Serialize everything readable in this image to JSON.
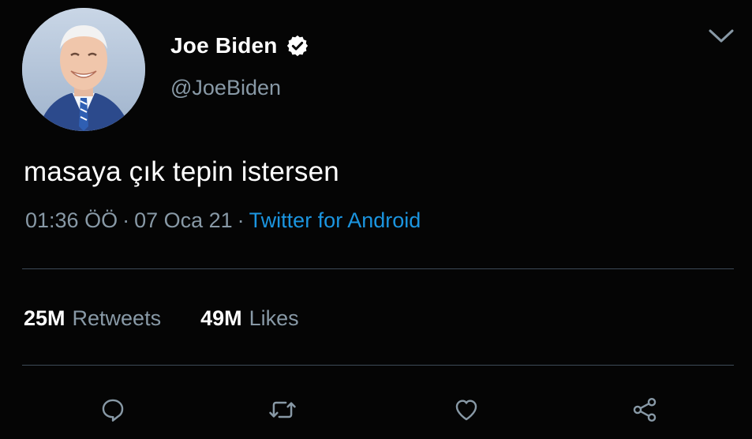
{
  "author": {
    "display_name": "Joe Biden",
    "handle": "@JoeBiden",
    "verified": true,
    "avatar_icon": "profile-photo"
  },
  "tweet": {
    "text": "masaya çık tepin istersen",
    "time": "01:36 ÖÖ",
    "date": "07 Oca 21",
    "separator": "·",
    "source": "Twitter for Android"
  },
  "stats": {
    "retweets_count": "25M",
    "retweets_label": "Retweets",
    "likes_count": "49M",
    "likes_label": "Likes"
  },
  "actions": [
    {
      "icon": "reply-icon"
    },
    {
      "icon": "retweet-icon"
    },
    {
      "icon": "like-icon"
    },
    {
      "icon": "share-icon"
    }
  ],
  "colors": {
    "background": "#050505",
    "text_primary": "#ffffff",
    "text_secondary": "#8899a6",
    "link": "#1b95e0",
    "divider": "#3d4a57"
  }
}
